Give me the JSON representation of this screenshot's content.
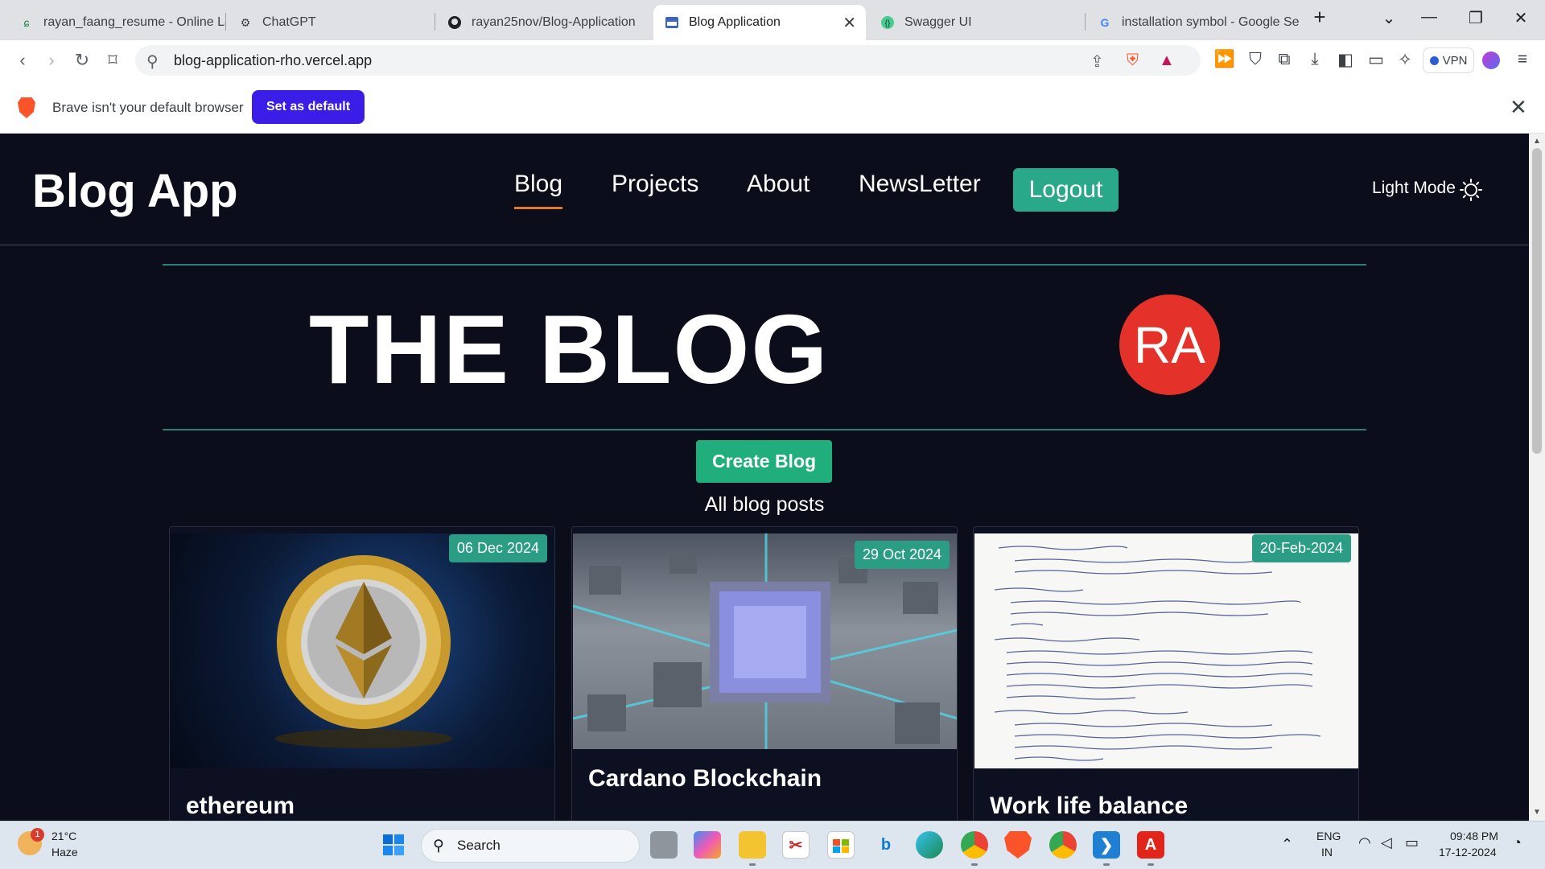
{
  "browser": {
    "tabs": [
      {
        "title": "rayan_faang_resume - Online LaTeX",
        "icon": "overleaf-icon"
      },
      {
        "title": "ChatGPT",
        "icon": "chatgpt-icon"
      },
      {
        "title": "rayan25nov/Blog-Application",
        "icon": "github-icon"
      },
      {
        "title": "Blog Application",
        "icon": "blog-icon",
        "active": true
      },
      {
        "title": "Swagger UI",
        "icon": "swagger-icon"
      },
      {
        "title": "installation symbol - Google Se",
        "icon": "google-icon"
      }
    ],
    "url": "blog-application-rho.vercel.app",
    "vpn_label": "VPN"
  },
  "infobar": {
    "message": "Brave isn't your default browser",
    "button": "Set as default"
  },
  "site": {
    "brand": "Blog App",
    "nav": [
      "Blog",
      "Projects",
      "About",
      "NewsLetter"
    ],
    "logout": "Logout",
    "theme_toggle": "Light Mode",
    "hero_title": "THE BLOG",
    "avatar_initials": "RA",
    "create_button": "Create Blog",
    "section_title": "All blog posts",
    "posts": [
      {
        "date": "06 Dec 2024",
        "title": "ethereum"
      },
      {
        "date": "29 Oct 2024",
        "title": "Cardano Blockchain"
      },
      {
        "date": "20-Feb-2024",
        "title": "Work life balance"
      }
    ]
  },
  "taskbar": {
    "temperature": "21°C",
    "condition": "Haze",
    "notification_count": "1",
    "search_placeholder": "Search",
    "lang_top": "ENG",
    "lang_bottom": "IN",
    "time": "09:48 PM",
    "date": "17-12-2024"
  },
  "colors": {
    "page_bg": "#0b0d1a",
    "accent_teal": "#2aa88a",
    "create_green": "#1fae7c",
    "avatar_red": "#e4322b",
    "nav_underline": "#e07a2a",
    "brave_blue": "#3a1ee8"
  }
}
